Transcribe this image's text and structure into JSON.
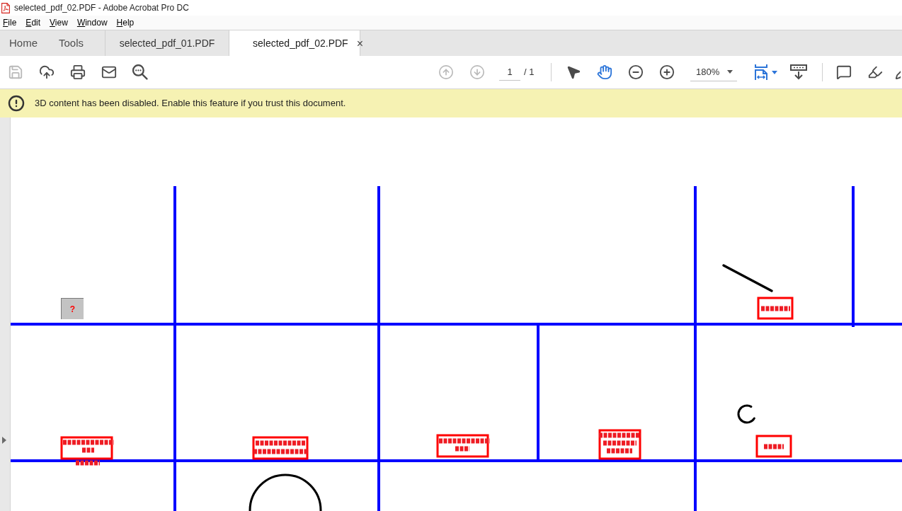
{
  "window": {
    "title": "selected_pdf_02.PDF - Adobe Acrobat Pro DC"
  },
  "menu": [
    {
      "label": "File"
    },
    {
      "label": "Edit"
    },
    {
      "label": "View"
    },
    {
      "label": "Window"
    },
    {
      "label": "Help"
    }
  ],
  "nav": [
    {
      "label": "Home"
    },
    {
      "label": "Tools"
    }
  ],
  "tabs": [
    {
      "label": "selected_pdf_01.PDF",
      "selected": false
    },
    {
      "label": "selected_pdf_02.PDF",
      "selected": true,
      "close": "×"
    }
  ],
  "toolbar": {
    "file_tools": [
      {
        "kind": "save",
        "disabled": true
      },
      {
        "kind": "upload",
        "disabled": false
      },
      {
        "kind": "print",
        "disabled": false
      },
      {
        "kind": "mail",
        "disabled": false
      },
      {
        "kind": "search",
        "disabled": false
      }
    ],
    "page_nav": [
      {
        "kind": "previous",
        "disabled": true
      },
      {
        "kind": "next",
        "disabled": true
      }
    ],
    "page": {
      "value": "1",
      "total": "/ 1"
    },
    "tools": [
      {
        "kind": "select",
        "selected": false
      },
      {
        "kind": "hand",
        "selected": true
      },
      {
        "kind": "zoom_out",
        "selected": false
      },
      {
        "kind": "zoom_in",
        "selected": false
      }
    ],
    "zoom": {
      "value": "180%"
    },
    "view_tools": [
      {
        "kind": "fit_page"
      },
      {
        "kind": "scroll"
      }
    ],
    "markup_tools": [
      {
        "kind": "comment"
      },
      {
        "kind": "highlight"
      },
      {
        "kind": "partial"
      }
    ]
  },
  "banner": {
    "message": "3D content has been disabled. Enable this feature if you trust this document."
  },
  "document": {
    "placeholder_mark": "?"
  }
}
